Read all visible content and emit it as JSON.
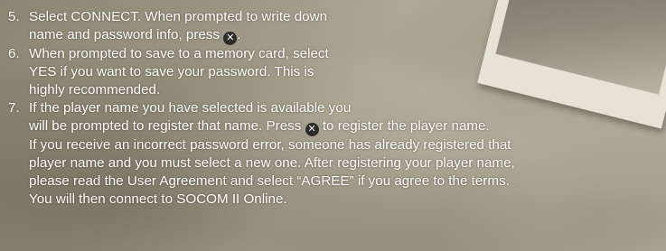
{
  "steps": [
    {
      "number": "5.",
      "line1": "Select CONNECT. When prompted to write down",
      "line2a": "name and password info, press",
      "line2b": "."
    },
    {
      "number": "6.",
      "line1": "When prompted to save to a memory card, select",
      "line2": "YES if you want to save your password. This is",
      "line3": "highly recommended."
    },
    {
      "number": "7.",
      "line1": "If the player name you have selected is available you",
      "line2a": "will be prompted to register that name. Press",
      "line2b": "to register the player name.",
      "line3": "If you receive an incorrect password error, someone has already registered that",
      "line4": "player name and you must select a new one. After registering your player name,",
      "line5": "please read the User Agreement and select “AGREE” if you agree to the terms.",
      "line6": "You will then connect to SOCOM II Online."
    }
  ],
  "icons": {
    "x_button": "✕"
  }
}
